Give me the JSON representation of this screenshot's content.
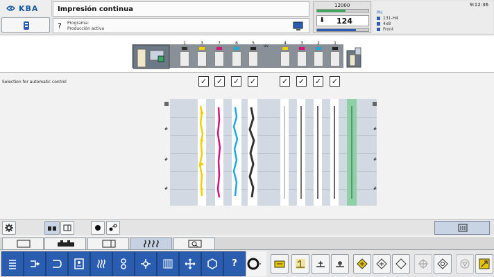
{
  "header": {
    "brand": "KBA",
    "title": "Impresión continua",
    "help_glyph": "?",
    "program_line": "Programa:",
    "production_line": "Producción activa",
    "speed_value": "12000",
    "speed_bar_fraction": 0.55,
    "setpoint_arrow": "⬇",
    "setpoint_value": "124",
    "setpoint_bar_fraction": 0.75,
    "time": "9:12:36",
    "info_header": "PH",
    "info_rows": [
      "131-H4",
      "4x8",
      "Front"
    ],
    "info_colors": [
      "#2a5db0",
      "#2a5db0",
      "#2a5db0"
    ]
  },
  "press": {
    "units": [
      {
        "num": "1",
        "ink": "#333333"
      },
      {
        "num": "3",
        "ink": "#f2d000"
      },
      {
        "num": "7",
        "ink": "#d4147c"
      },
      {
        "num": "6",
        "ink": "#1ea8dc"
      },
      {
        "num": "5",
        "ink": "#222222"
      },
      {
        "num": "",
        "ink": ""
      },
      {
        "num": "4",
        "ink": "#f2d000"
      },
      {
        "num": "3",
        "ink": "#d4147c"
      },
      {
        "num": "2",
        "ink": "#1ea8dc"
      },
      {
        "num": "1",
        "ink": "#222222"
      }
    ],
    "web_marker": "vv"
  },
  "selection": {
    "label": "Selection for automatic control",
    "checkmark": "✓",
    "checked": [
      true,
      true,
      true,
      true,
      true,
      true,
      true,
      true
    ]
  },
  "profile": {
    "left_marks": [
      "#",
      "#",
      "#"
    ],
    "right_marks": [
      "#",
      "#",
      "#"
    ]
  },
  "colors": {
    "accent_blue": "#2a5db0",
    "zone_green": "#8fd1a6",
    "yellow": "#f2d000",
    "magenta": "#d4147c",
    "cyan": "#1ea8dc",
    "black": "#222222"
  },
  "icons": {
    "settings": "gear-icon",
    "help_nav": "?"
  }
}
